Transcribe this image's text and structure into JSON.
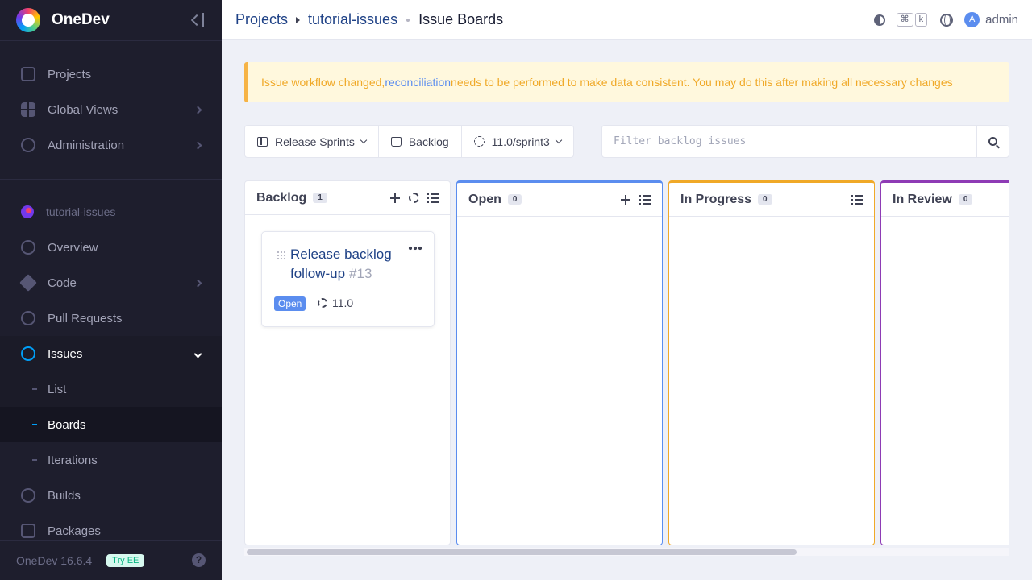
{
  "app": {
    "name": "OneDev",
    "version": "OneDev 16.6.4",
    "try_ee": "Try EE"
  },
  "sidebar": {
    "top_items": [
      {
        "label": "Projects",
        "icon": "project-icon"
      },
      {
        "label": "Global Views",
        "icon": "grid-icon"
      },
      {
        "label": "Administration",
        "icon": "gear-icon"
      }
    ],
    "project_name": "tutorial-issues",
    "project_items": [
      {
        "label": "Overview",
        "icon": "gauge-icon"
      },
      {
        "label": "Code",
        "icon": "git-icon"
      },
      {
        "label": "Pull Requests",
        "icon": "pull-request-icon"
      },
      {
        "label": "Issues",
        "icon": "issues-icon"
      }
    ],
    "issue_subitems": [
      {
        "label": "List"
      },
      {
        "label": "Boards"
      },
      {
        "label": "Iterations"
      }
    ],
    "bottom_items": [
      {
        "label": "Builds",
        "icon": "play-icon"
      },
      {
        "label": "Packages",
        "icon": "package-icon"
      }
    ]
  },
  "header": {
    "breadcrumb": [
      "Projects",
      "tutorial-issues"
    ],
    "current": "Issue Boards",
    "shortcut_keys": [
      "⌘",
      "k"
    ],
    "user": {
      "initial": "A",
      "name": "admin"
    }
  },
  "alert": {
    "prefix": "Issue workflow changed, ",
    "link": "reconciliation",
    "suffix": " needs to be performed to make data consistent. You may do this after making all necessary changes"
  },
  "toolbar": {
    "board": "Release Sprints",
    "backlog": "Backlog",
    "iteration": "11.0/sprint3"
  },
  "filter": {
    "placeholder": "Filter backlog issues"
  },
  "columns": [
    {
      "title": "Backlog",
      "count": "1",
      "color": "#e4e6ef"
    },
    {
      "title": "Open",
      "count": "0",
      "color": "#5b8def"
    },
    {
      "title": "In Progress",
      "count": "0",
      "color": "#f0a928"
    },
    {
      "title": "In Review",
      "count": "0",
      "color": "#8e3bb5"
    }
  ],
  "cards": [
    {
      "title": "Release backlog follow-up",
      "number": "#13",
      "state": "Open",
      "iteration": "11.0"
    }
  ],
  "colors": {
    "accent": "#009ef7",
    "sidebar_bg": "#1e1e2d",
    "link": "#1e4186",
    "warning": "#f0a928"
  }
}
